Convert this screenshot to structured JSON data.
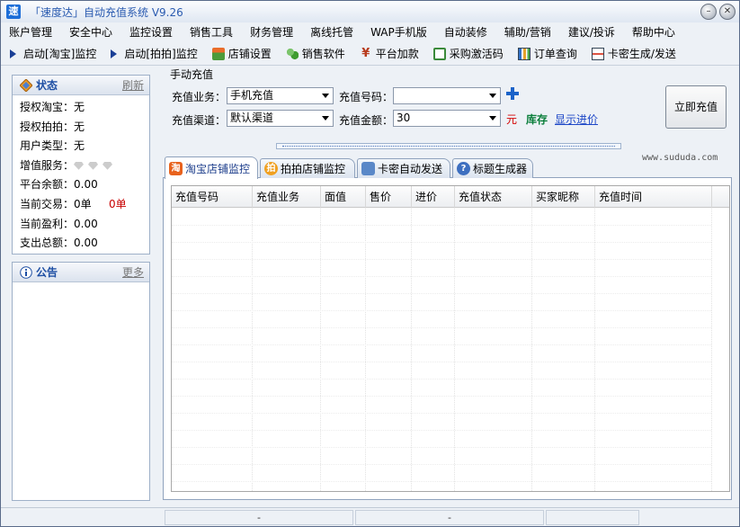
{
  "app": {
    "icon_char": "速",
    "title": "「速度达」自动充值系统 V9.26",
    "minimize_glyph": "–",
    "close_glyph": "✕"
  },
  "menu": [
    "账户管理",
    "安全中心",
    "监控设置",
    "销售工具",
    "财务管理",
    "离线托管",
    "WAP手机版",
    "自动装修",
    "辅助/营销",
    "建议/投诉",
    "帮助中心"
  ],
  "toolbar": [
    {
      "label": "启动[淘宝]监控",
      "icon": "play-icon"
    },
    {
      "label": "启动[拍拍]监控",
      "icon": "play-icon"
    },
    {
      "label": "店铺设置",
      "icon": "shop-icon"
    },
    {
      "label": "销售软件",
      "icon": "people-icon"
    },
    {
      "label": "平台加款",
      "icon": "yuan-icon"
    },
    {
      "label": "采购激活码",
      "icon": "cart-icon"
    },
    {
      "label": "订单查询",
      "icon": "chart-icon"
    },
    {
      "label": "卡密生成/发送",
      "icon": "card-icon"
    }
  ],
  "status_panel": {
    "title": "状态",
    "refresh": "刷新",
    "rows": [
      {
        "label": "授权淘宝：",
        "value": "无"
      },
      {
        "label": "授权拍拍：",
        "value": "无"
      },
      {
        "label": "用户类型：",
        "value": "无"
      },
      {
        "label": "增值服务：",
        "value": ""
      },
      {
        "label": "平台余额：",
        "value": "0.00"
      },
      {
        "label": "当前交易：",
        "value": "0单",
        "extra": "0单"
      },
      {
        "label": "当前盈利：",
        "value": "0.00"
      },
      {
        "label": "支出总额：",
        "value": "0.00"
      }
    ]
  },
  "notice_panel": {
    "title": "公告",
    "more": "更多"
  },
  "manual": {
    "title": "手动充值",
    "business_label": "充值业务：",
    "business_value": "手机充值",
    "channel_label": "充值渠道：",
    "channel_value": "默认渠道",
    "number_label": "充值号码：",
    "number_value": "",
    "amount_label": "充值金额：",
    "amount_value": "30",
    "yuan": "元",
    "stock": "库存",
    "show_price": "显示进价",
    "submit": "立即充值"
  },
  "site_url": "www.sududa.com",
  "tabs": [
    {
      "label": "淘宝店铺监控",
      "icon_char": "淘",
      "active": true
    },
    {
      "label": "拍拍店铺监控",
      "icon_char": "拍",
      "active": false
    },
    {
      "label": "卡密自动发送",
      "icon_char": "",
      "active": false
    },
    {
      "label": "标题生成器",
      "icon_char": "?",
      "active": false
    }
  ],
  "grid": {
    "columns": [
      "充值号码",
      "充值业务",
      "面值",
      "售价",
      "进价",
      "充值状态",
      "买家昵称",
      "充值时间"
    ],
    "rows": []
  },
  "statusbar": {
    "cell1": "-",
    "cell2": "-"
  }
}
